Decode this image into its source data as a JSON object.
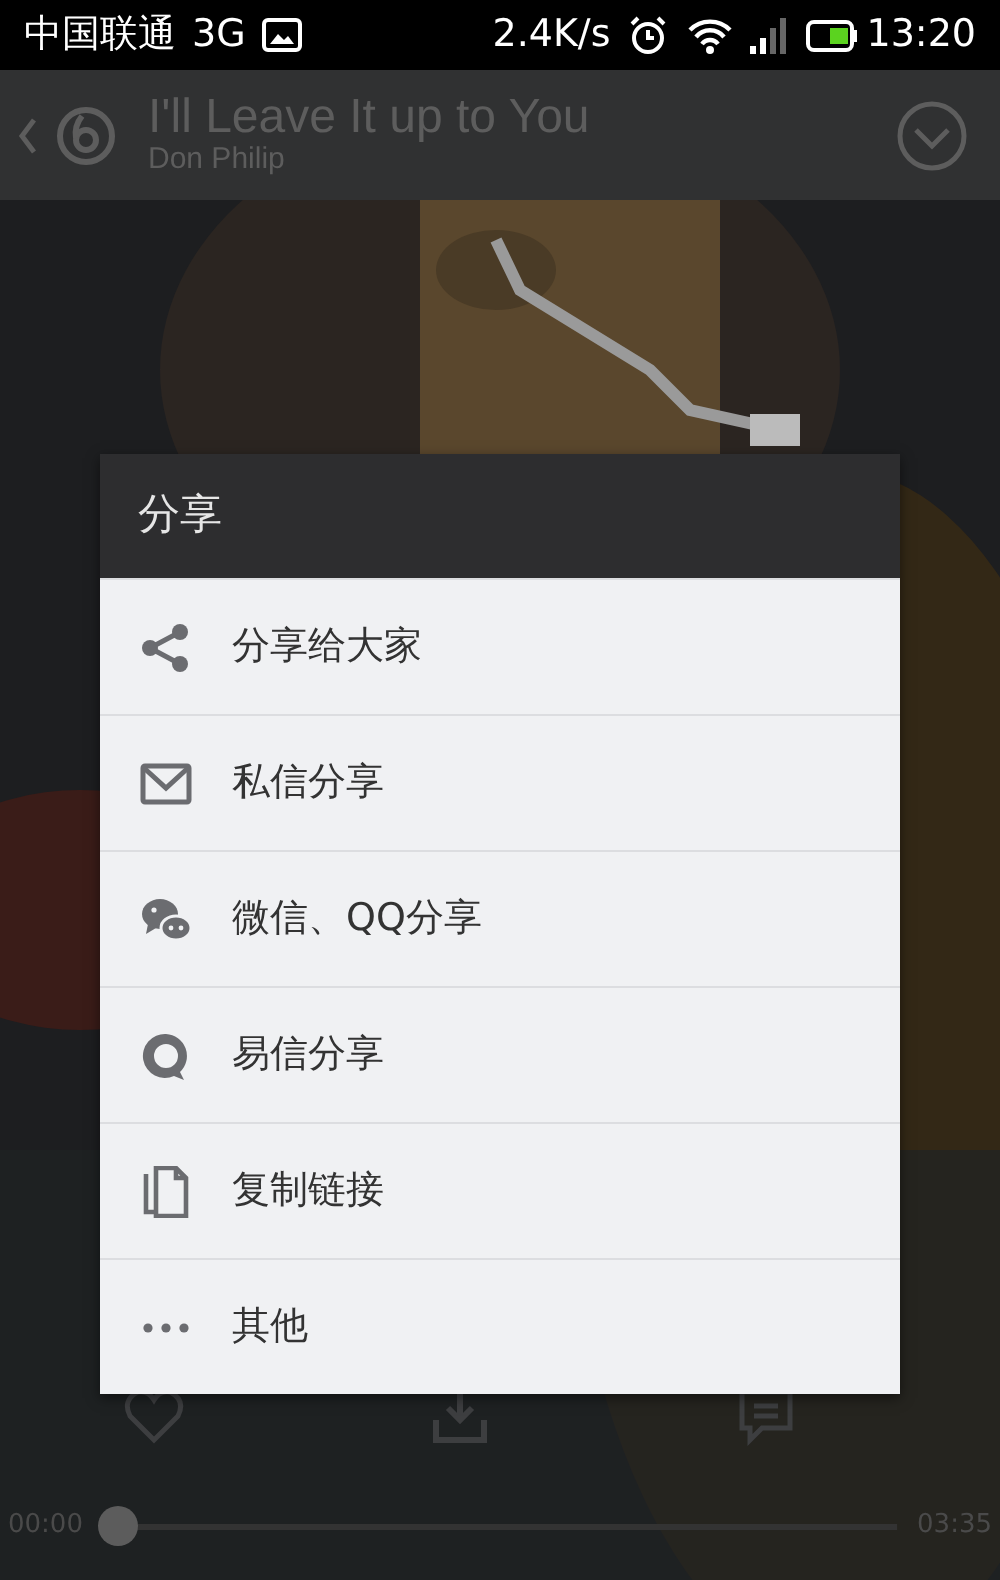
{
  "status_bar": {
    "carrier": "中国联通",
    "network": "3G",
    "speed": "2.4K/s",
    "time": "13:20"
  },
  "player": {
    "title": "I'll Leave It up to You",
    "artist": "Don Philip",
    "elapsed": "00:00",
    "total": "03:35",
    "level": 0
  },
  "dialog": {
    "title": "分享",
    "items": [
      {
        "kind": "share",
        "label": "分享给大家"
      },
      {
        "kind": "mail",
        "label": "私信分享"
      },
      {
        "kind": "chat",
        "label": "微信、QQ分享"
      },
      {
        "kind": "yixin",
        "label": "易信分享"
      },
      {
        "kind": "copy",
        "label": "复制链接"
      },
      {
        "kind": "more",
        "label": "其他"
      }
    ]
  }
}
